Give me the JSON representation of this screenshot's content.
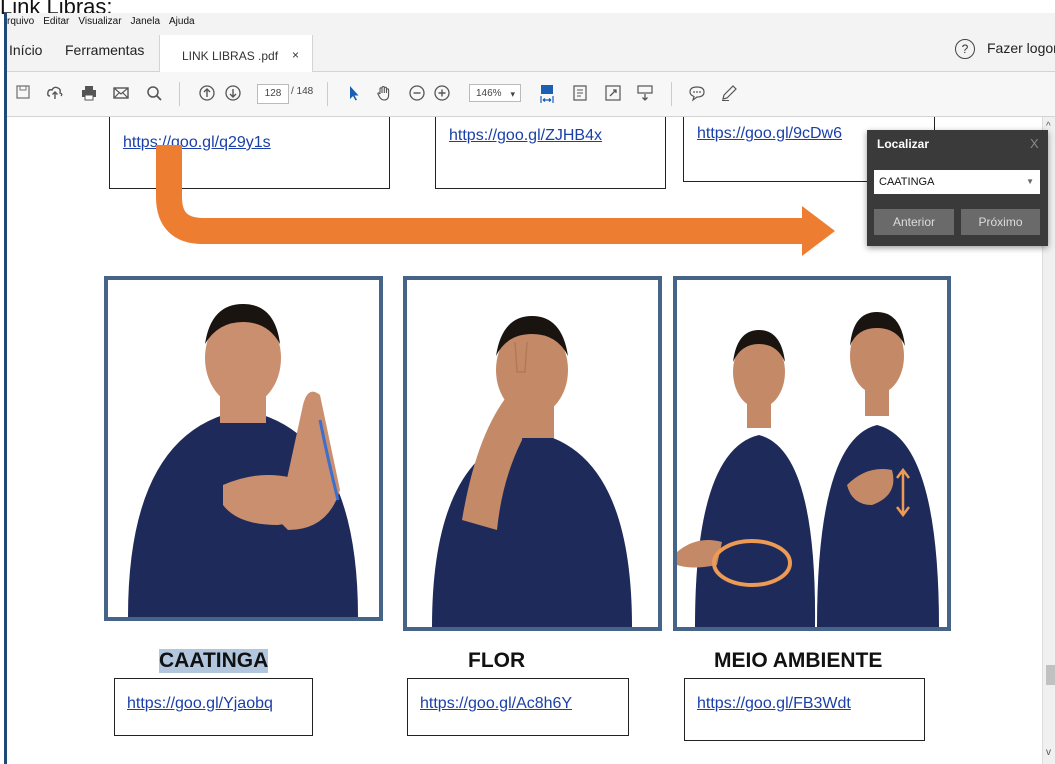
{
  "outer_title": "Link Libras:",
  "menu": [
    "rquivo",
    "Editar",
    "Visualizar",
    "Janela",
    "Ajuda"
  ],
  "tabs": {
    "home": "Início",
    "tools": "Ferramentas",
    "document": "LINK LIBRAS .pdf",
    "close": "×"
  },
  "header": {
    "help": "?",
    "logout": "Fazer logon"
  },
  "toolbar": {
    "page_current": "128",
    "page_total": "/ 148",
    "zoom": "146%",
    "zoom_arrow": "▾"
  },
  "top_links": [
    "https://goo.gl/q29y1s",
    "https://goo.gl/ZJHB4x",
    "https://goo.gl/9cDw6"
  ],
  "cards": [
    {
      "caption": "CAATINGA",
      "link": "https://goo.gl/Yjaobq"
    },
    {
      "caption": "FLOR",
      "link": "https://goo.gl/Ac8h6Y"
    },
    {
      "caption": "MEIO AMBIENTE",
      "link": "https://goo.gl/FB3Wdt"
    }
  ],
  "find_panel": {
    "title": "Localizar",
    "close": "X",
    "query": "CAATINGA",
    "prev": "Anterior",
    "next": "Próximo"
  },
  "colors": {
    "accent_arrow": "#ed7d31",
    "frame": "#456487",
    "highlight": "#b2c7de"
  }
}
